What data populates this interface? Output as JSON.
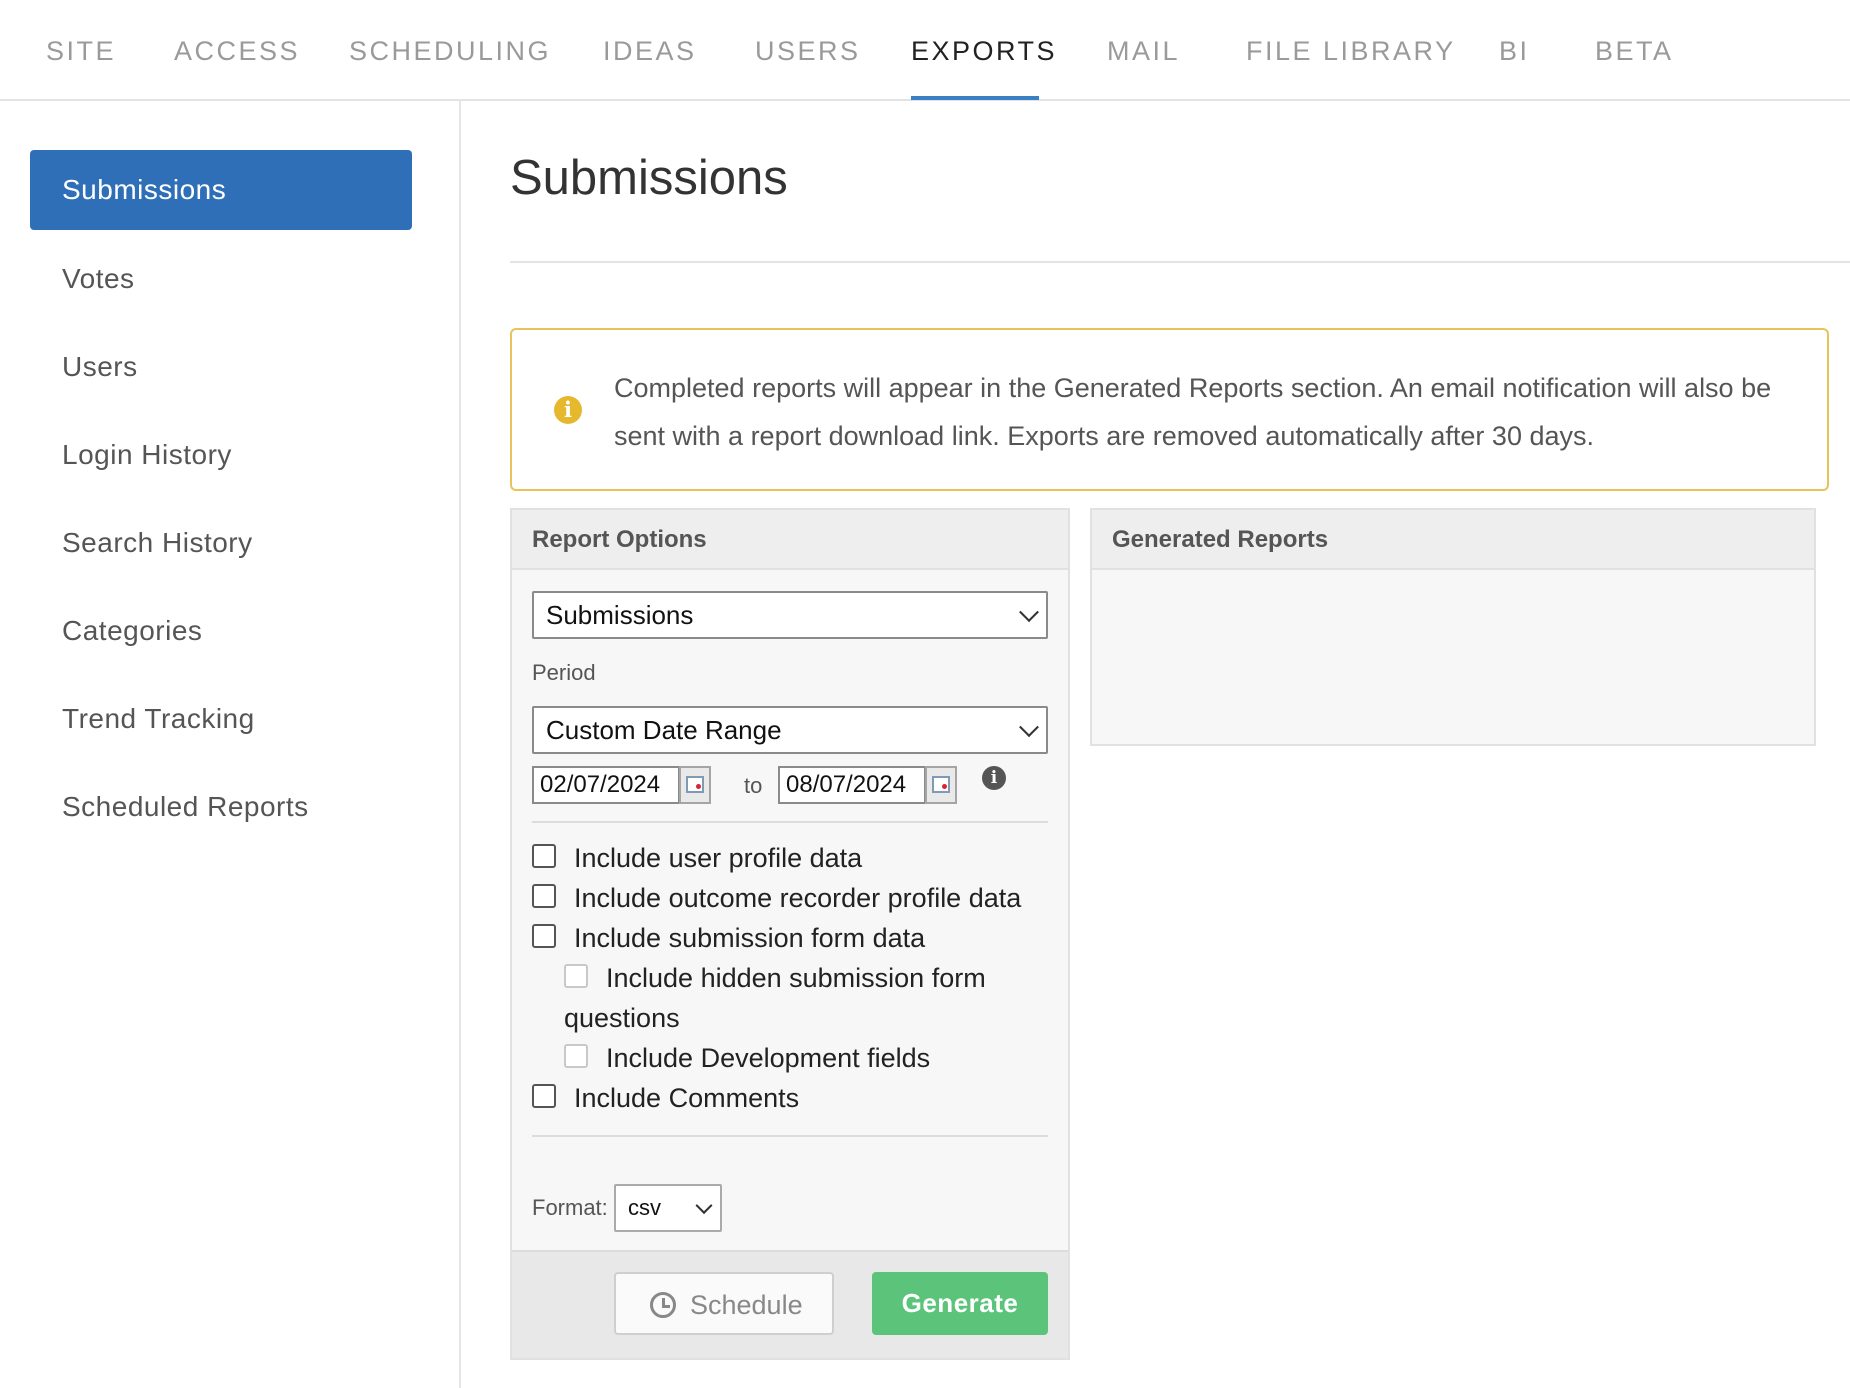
{
  "top_nav": {
    "tabs": [
      {
        "label": "SITE"
      },
      {
        "label": "ACCESS"
      },
      {
        "label": "SCHEDULING"
      },
      {
        "label": "IDEAS"
      },
      {
        "label": "USERS"
      },
      {
        "label": "EXPORTS",
        "active": true
      },
      {
        "label": "MAIL"
      },
      {
        "label": "FILE LIBRARY"
      },
      {
        "label": "BI"
      },
      {
        "label": "BETA"
      }
    ]
  },
  "sidebar": {
    "items": [
      {
        "label": "Submissions",
        "active": true
      },
      {
        "label": "Votes"
      },
      {
        "label": "Users"
      },
      {
        "label": "Login History"
      },
      {
        "label": "Search History"
      },
      {
        "label": "Categories"
      },
      {
        "label": "Trend Tracking"
      },
      {
        "label": "Scheduled Reports"
      }
    ]
  },
  "main": {
    "title": "Submissions",
    "notice": {
      "icon": "info-icon",
      "text": "Completed reports will appear in the Generated Reports section. An email notification will also be sent with a report download link. Exports are removed automatically after 30 days."
    },
    "report_options": {
      "heading": "Report Options",
      "report_type": "Submissions",
      "period_label": "Period",
      "period_value": "Custom Date Range",
      "date_from": "02/07/2024",
      "date_to_label": "to",
      "date_to": "08/07/2024",
      "checkboxes": {
        "user_profile": "Include user profile data",
        "outcome_recorder": "Include outcome recorder profile data",
        "submission_form": "Include submission form data",
        "hidden_questions_line1": "Include hidden submission form",
        "hidden_questions_line2": "questions",
        "development_fields": "Include Development fields",
        "comments": "Include Comments"
      },
      "format_label": "Format:",
      "format_value": "csv",
      "schedule_button": "Schedule",
      "generate_button": "Generate"
    },
    "generated_reports": {
      "heading": "Generated Reports"
    }
  },
  "colors": {
    "primary": "#2f6fb8",
    "tab_underline": "#3a7ec4",
    "notice_border": "#e8c25a",
    "generate": "#5cc47a"
  }
}
